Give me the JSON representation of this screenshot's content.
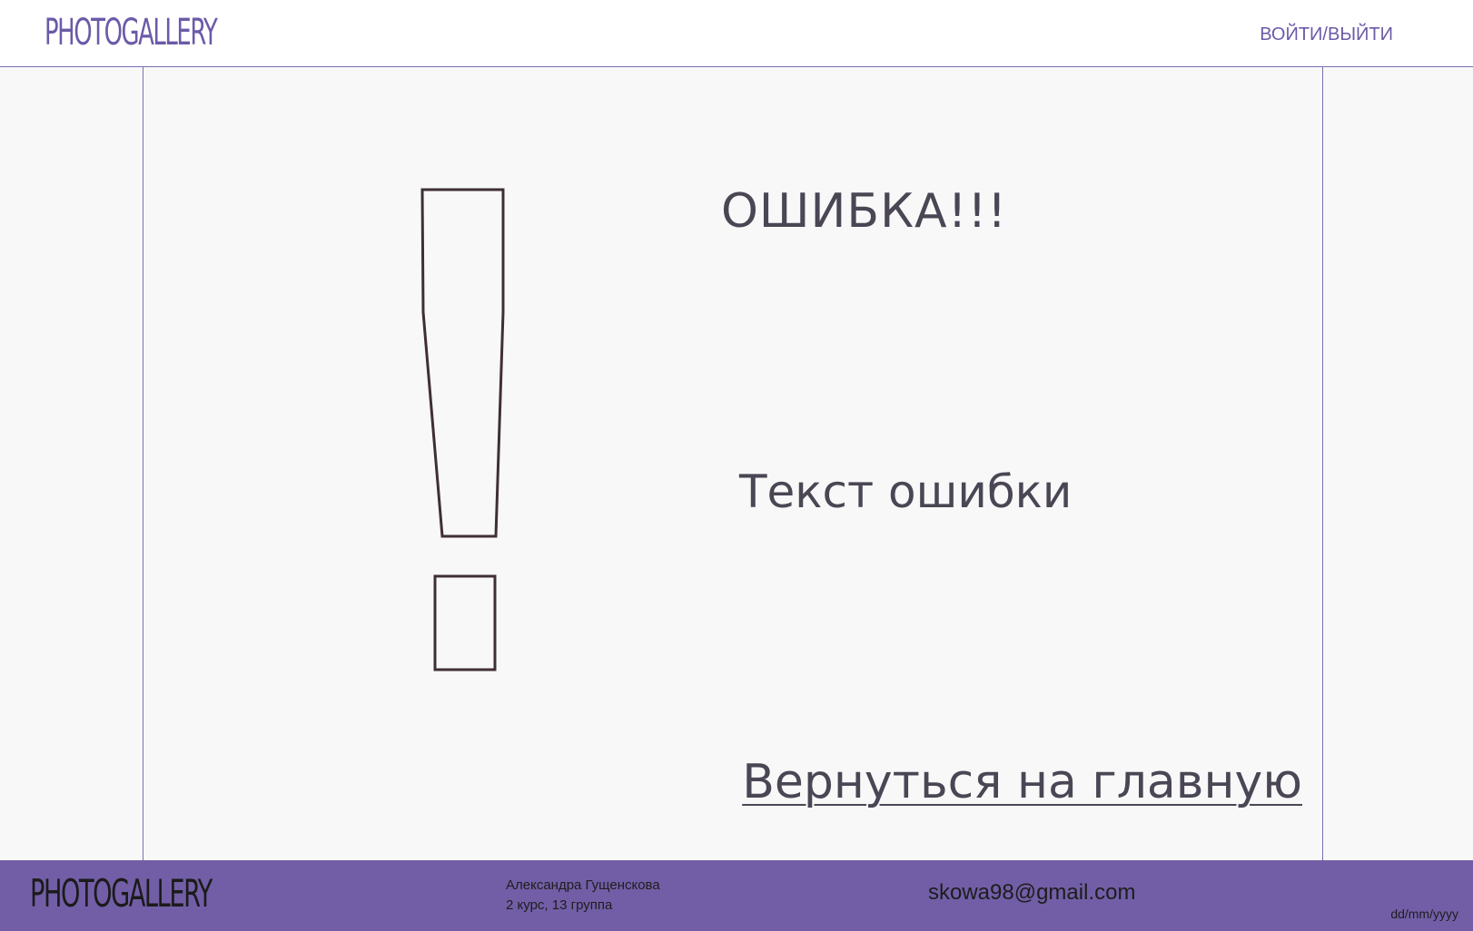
{
  "header": {
    "logo": "PHOTOGALLERY",
    "login_label": "ВОЙТИ/ВЫЙТИ"
  },
  "main": {
    "title": "ОШИБКА!!!",
    "error_text": "Текст ошибки",
    "back_link": "Вернуться на главную",
    "icon": "exclamation-mark-icon"
  },
  "footer": {
    "logo": "PHOTOGALLERY",
    "author_name": "Александра Гущенскова",
    "author_info": "2 курс, 13 группа",
    "email": "skowa98@gmail.com",
    "date": "dd/mm/yyyy"
  },
  "colors": {
    "accent": "#725ea6",
    "text": "#4a4654",
    "icon_stroke": "#3f2f33"
  }
}
